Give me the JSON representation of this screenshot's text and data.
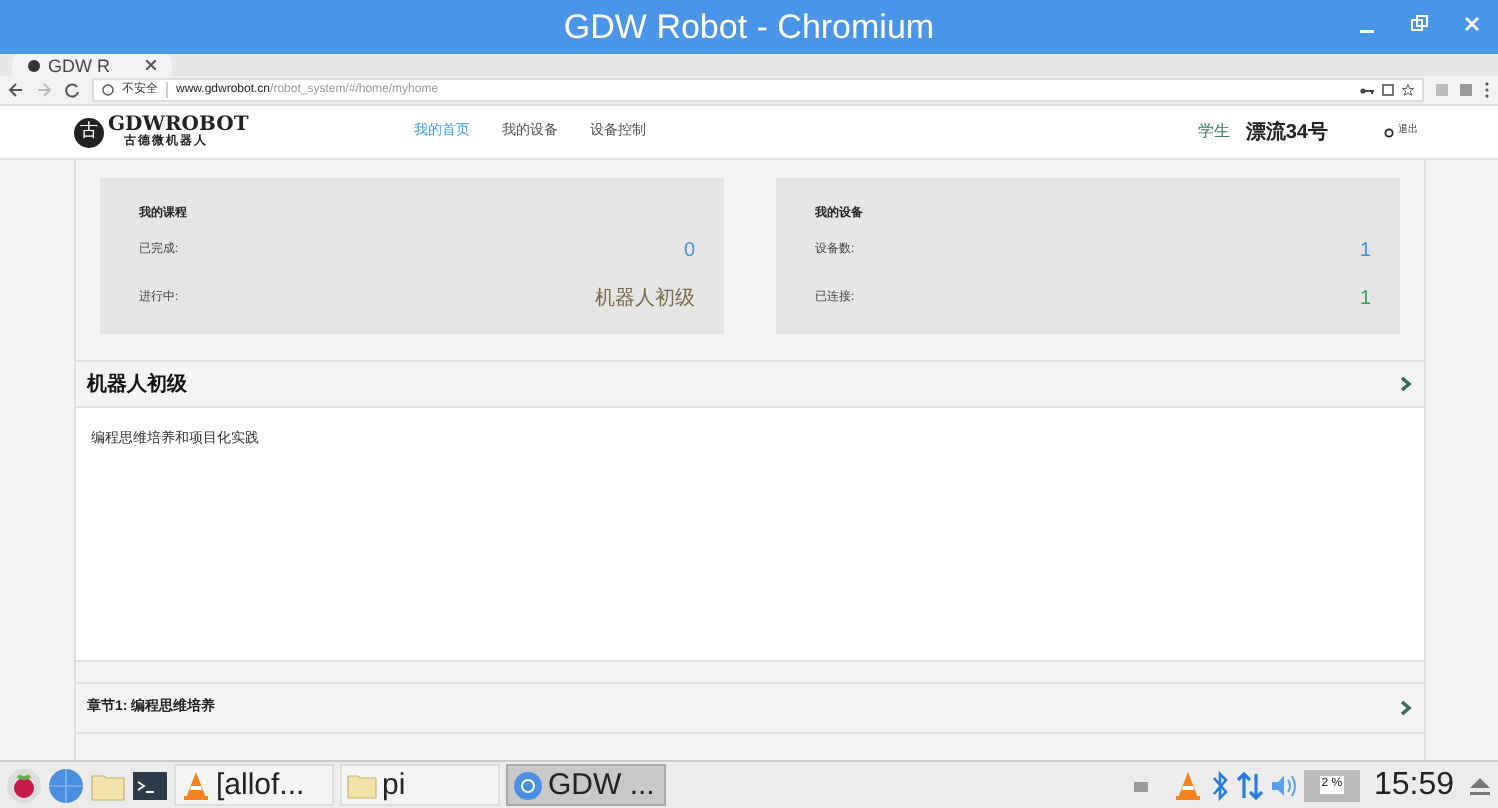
{
  "window": {
    "title": "GDW Robot - Chromium"
  },
  "browser": {
    "tab_title": "GDW R",
    "security_label": "不安全",
    "url_host": "www.gdwrobot.cn",
    "url_path": "/robot_system/#/home/myhome"
  },
  "header": {
    "logo_mark": "古",
    "logo_text": "GDWROBOT",
    "logo_subtitle": "古德微机器人",
    "nav": [
      {
        "label": "我的首页",
        "selected": true
      },
      {
        "label": "我的设备",
        "selected": false
      },
      {
        "label": "设备控制",
        "selected": false
      }
    ],
    "role": "学生",
    "user": "漂流34号",
    "logout": "退出"
  },
  "cards": [
    {
      "title": "我的课程",
      "rows": [
        {
          "label": "已完成:",
          "value": "0",
          "color": "#4a90d9"
        },
        {
          "label": "进行中:",
          "value": "机器人初级",
          "color": "#7a6a4a"
        }
      ]
    },
    {
      "title": "我的设备",
      "rows": [
        {
          "label": "设备数:",
          "value": "1",
          "color": "#4a90d9"
        },
        {
          "label": "已连接:",
          "value": "1",
          "color": "#3c9a5a"
        }
      ]
    }
  ],
  "course": {
    "title": "机器人初级",
    "description": "编程思维培养和项目化实践"
  },
  "chapter": {
    "title": "章节1: 编程思维培养"
  },
  "taskbar": {
    "apps": [
      {
        "label": "[allof...",
        "kind": "vlc",
        "selected": false
      },
      {
        "label": "pi",
        "kind": "folder",
        "selected": false
      },
      {
        "label": "GDW ...",
        "kind": "chromium",
        "selected": true
      }
    ],
    "cpu": "2 %",
    "clock": "15:59"
  }
}
